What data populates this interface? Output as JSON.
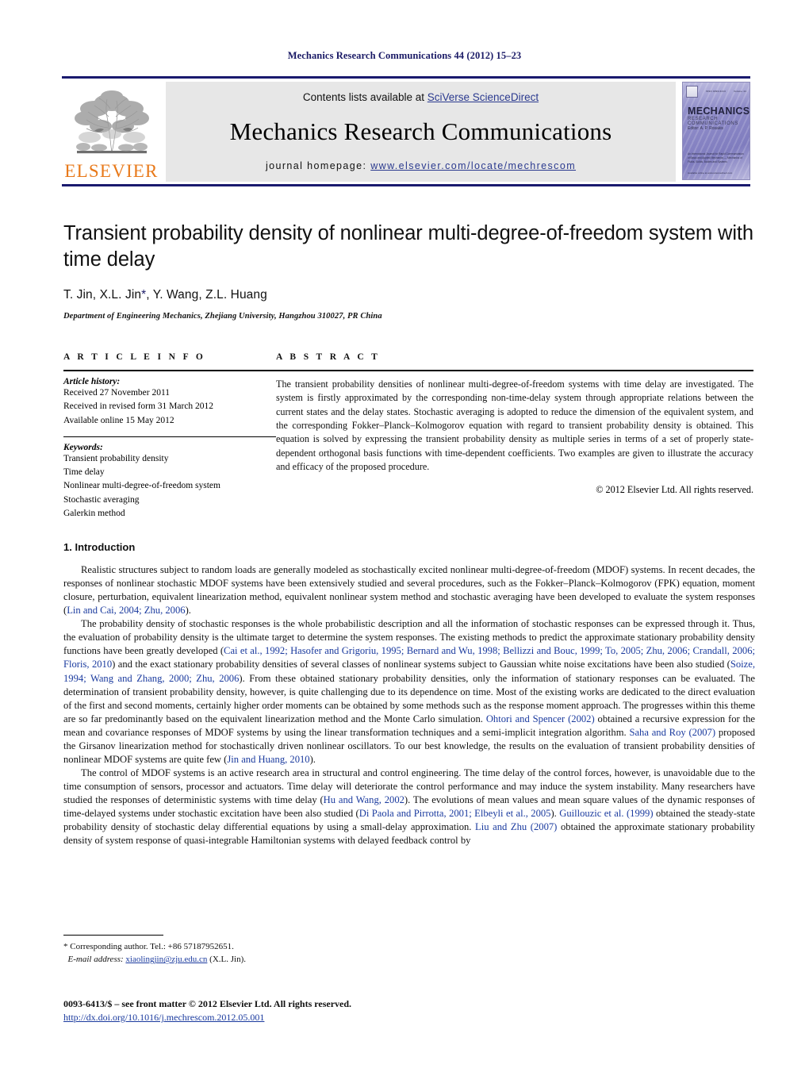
{
  "running_head": "Mechanics Research Communications 44 (2012) 15–23",
  "banner": {
    "publisher_name": "ELSEVIER",
    "contents_prefix": "Contents lists available at ",
    "contents_link": "SciVerse ScienceDirect",
    "journal_name": "Mechanics Research Communications",
    "homepage_prefix": "journal homepage: ",
    "homepage_url": "www.elsevier.com/locate/mechrescom",
    "cover": {
      "title": "MECHANICS",
      "subtitle": "RESEARCH COMMUNICATIONS",
      "editor": "Editor: A. P. Rosakis",
      "top_left_tiny": "ISSN 0093-6413",
      "top_right_tiny": "Volume 44",
      "blurb": "An International Journal for Rapid Communication of Basic and Applied Mechanics — Mechanics of Fluids, Solids, Bodies and Systems",
      "footer_tiny": "Available online at\nwww.sciencedirect.com"
    }
  },
  "article": {
    "title": "Transient probability density of nonlinear multi-degree-of-freedom system with time delay",
    "authors": "T. Jin, X.L. Jin",
    "authors_tail": ", Y. Wang, Z.L. Huang",
    "corresponding_marker": "*",
    "affiliation": "Department of Engineering Mechanics, Zhejiang University, Hangzhou 310027, PR China"
  },
  "article_info": {
    "heading": "A R T I C L E    I N F O",
    "history_label": "Article history:",
    "history": [
      "Received 27 November 2011",
      "Received in revised form 31 March 2012",
      "Available online 15 May 2012"
    ],
    "keywords_label": "Keywords:",
    "keywords": [
      "Transient probability density",
      "Time delay",
      "Nonlinear multi-degree-of-freedom system",
      "Stochastic averaging",
      "Galerkin method"
    ]
  },
  "abstract": {
    "heading": "A B S T R A C T",
    "text": "The transient probability densities of nonlinear multi-degree-of-freedom systems with time delay are investigated. The system is firstly approximated by the corresponding non-time-delay system through appropriate relations between the current states and the delay states. Stochastic averaging is adopted to reduce the dimension of the equivalent system, and the corresponding Fokker–Planck–Kolmogorov equation with regard to transient probability density is obtained. This equation is solved by expressing the transient probability density as multiple series in terms of a set of properly state-dependent orthogonal basis functions with time-dependent coefficients. Two examples are given to illustrate the accuracy and efficacy of the proposed procedure.",
    "copyright": "© 2012 Elsevier Ltd. All rights reserved."
  },
  "section": {
    "heading": "1.  Introduction",
    "paragraphs": [
      {
        "segments": [
          {
            "t": "Realistic structures subject to random loads are generally modeled as stochastically excited nonlinear multi-degree-of-freedom (MDOF) systems. In recent decades, the responses of nonlinear stochastic MDOF systems have been extensively studied and several procedures, such as the Fokker–Planck–Kolmogorov (FPK) equation, moment closure, perturbation, equivalent linearization method, equivalent nonlinear system method and stochastic averaging have been developed to evaluate the system responses (",
            "c": false
          },
          {
            "t": "Lin and Cai, 2004; Zhu, 2006",
            "c": true
          },
          {
            "t": ").",
            "c": false
          }
        ]
      },
      {
        "segments": [
          {
            "t": "The probability density of stochastic responses is the whole probabilistic description and all the information of stochastic responses can be expressed through it. Thus, the evaluation of probability density is the ultimate target to determine the system responses. The existing methods to predict the approximate stationary probability density functions have been greatly developed (",
            "c": false
          },
          {
            "t": "Cai et al., 1992; Hasofer and Grigoriu, 1995; Bernard and Wu, 1998; Bellizzi and Bouc, 1999; To, 2005; Zhu, 2006; Crandall, 2006; Floris, 2010",
            "c": true
          },
          {
            "t": ") and the exact stationary probability densities of several classes of nonlinear systems subject to Gaussian white noise excitations have been also studied (",
            "c": false
          },
          {
            "t": "Soize, 1994; Wang and Zhang, 2000; Zhu, 2006",
            "c": true
          },
          {
            "t": "). From these obtained stationary probability densities, only the information of stationary responses can be evaluated. The determination of transient probability density, however, is quite challenging due to its dependence on time. Most of the existing works are dedicated to the direct evaluation of the first and second moments, certainly higher order moments can be obtained by some methods such as the response moment approach. The progresses within this theme are so far predominantly based on the equivalent linearization method and the Monte Carlo simulation. ",
            "c": false
          },
          {
            "t": "Ohtori and Spencer (2002)",
            "c": true
          },
          {
            "t": " obtained a recursive expression for the mean and covariance responses of MDOF systems by using the linear transformation techniques and a semi-implicit integration algorithm. ",
            "c": false
          },
          {
            "t": "Saha and Roy (2007)",
            "c": true
          },
          {
            "t": " proposed the Girsanov linearization method for stochastically driven nonlinear oscillators. To our best knowledge, the results on the evaluation of transient probability densities of nonlinear MDOF systems are quite few (",
            "c": false
          },
          {
            "t": "Jin and Huang, 2010",
            "c": true
          },
          {
            "t": ").",
            "c": false
          }
        ]
      },
      {
        "segments": [
          {
            "t": "The control of MDOF systems is an active research area in structural and control engineering. The time delay of the control forces, however, is unavoidable due to the time consumption of sensors, processor and actuators. Time delay will deteriorate the control performance and may induce the system instability. Many researchers have studied the responses of deterministic systems with time delay (",
            "c": false
          },
          {
            "t": "Hu and Wang, 2002",
            "c": true
          },
          {
            "t": "). The evolutions of mean values and mean square values of the dynamic responses of time-delayed systems under stochastic excitation have been also studied (",
            "c": false
          },
          {
            "t": "Di Paola and Pirrotta, 2001; Elbeyli et al., 2005",
            "c": true
          },
          {
            "t": "). ",
            "c": false
          },
          {
            "t": "Guillouzic et al. (1999)",
            "c": true
          },
          {
            "t": " obtained the steady-state probability density of stochastic delay differential equations by using a small-delay approximation. ",
            "c": false
          },
          {
            "t": "Liu and Zhu (2007)",
            "c": true
          },
          {
            "t": " obtained the approximate stationary probability density of system response of quasi-integrable Hamiltonian systems with delayed feedback control by",
            "c": false
          }
        ]
      }
    ]
  },
  "footnote": {
    "corresponding": "* Corresponding author. Tel.: +86 57187952651.",
    "email_label": "E-mail address:",
    "email": "xiaolingjin@zju.edu.cn",
    "email_suffix": " (X.L. Jin).",
    "issn_line": "0093-6413/$ – see front matter © 2012 Elsevier Ltd. All rights reserved.",
    "doi_line": "http://dx.doi.org/10.1016/j.mechrescom.2012.05.001"
  }
}
